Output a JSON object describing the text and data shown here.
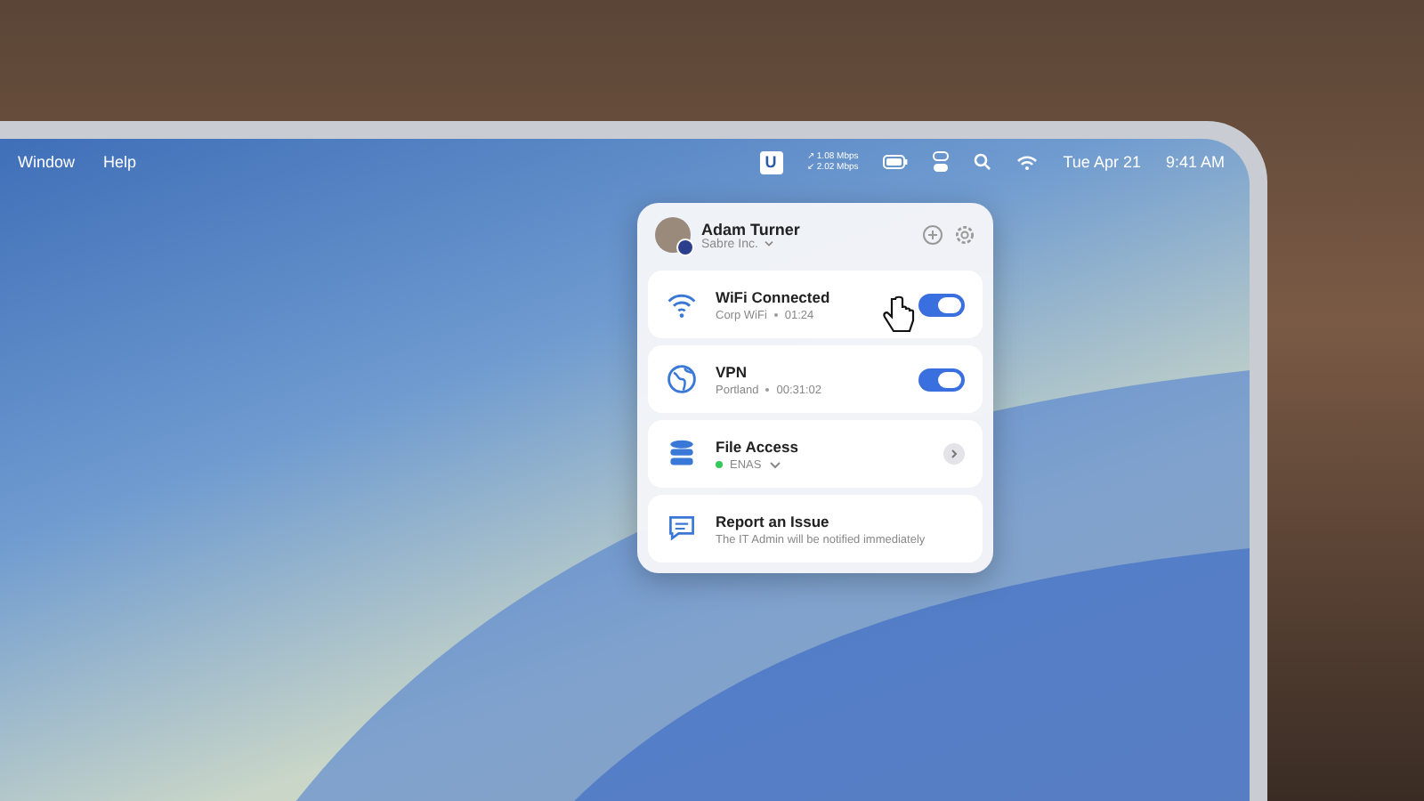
{
  "menu_bar": {
    "left_items": [
      "Window",
      "Help"
    ],
    "app_icon_letter": "U",
    "upload_speed": "↗ 1.08 Mbps",
    "download_speed": "↙ 2.02 Mbps",
    "date": "Tue Apr 21",
    "time": "9:41 AM"
  },
  "popup": {
    "user": {
      "name": "Adam Turner",
      "organization": "Sabre Inc."
    },
    "items": [
      {
        "kind": "toggle",
        "title": "WiFi Connected",
        "subtitle": "Corp WiFi",
        "detail": "01:24",
        "on": true
      },
      {
        "kind": "toggle",
        "title": "VPN",
        "subtitle": "Portland",
        "detail": "00:31:02",
        "on": true
      },
      {
        "kind": "nav",
        "title": "File Access",
        "subtitle": "ENAS",
        "color": "#34c759"
      },
      {
        "kind": "report",
        "title": "Report an Issue",
        "subtitle": "The IT Admin will be notified immediately"
      }
    ]
  }
}
